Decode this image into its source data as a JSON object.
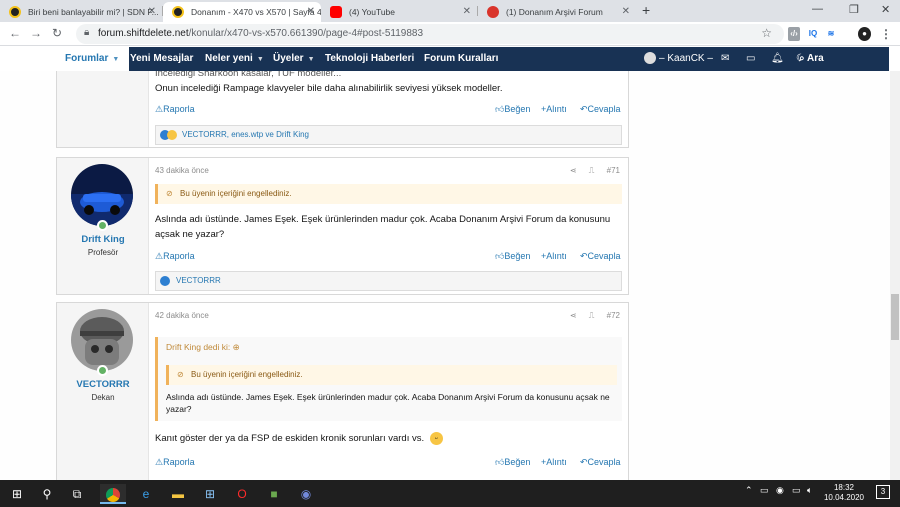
{
  "browser": {
    "tabs": [
      {
        "title": "Biri beni banlayabilir mi? | SDN F...",
        "active": false
      },
      {
        "title": "Donanım - X470 vs X570 | Sayfa 4",
        "active": true
      },
      {
        "title": "(4) YouTube",
        "active": false
      },
      {
        "title": "(1) Donanım Arşivi Forum",
        "active": false
      }
    ],
    "url_host": "forum.shiftdelete.net",
    "url_path": "/konular/x470-vs-x570.661390/page-4#post-5119883",
    "ext_iq": "IQ"
  },
  "nav": {
    "items": [
      {
        "label": "Forumlar"
      },
      {
        "label": "Yeni Mesajlar"
      },
      {
        "label": "Neler yeni"
      },
      {
        "label": "Üyeler"
      },
      {
        "label": "Teknoloji Haberleri"
      },
      {
        "label": "Forum Kuralları"
      }
    ],
    "user": "– KaanCK –",
    "search": "Ara"
  },
  "post_top": {
    "line1": "İncelediği Sharkoon kasalar, TUF modeller...",
    "line2": "Onun incelediği Rampage klavyeler bile daha alınabilirlik seviyesi yüksek modeller.",
    "report": "Raporla",
    "like": "Beğen",
    "quote": "Alıntı",
    "reply": "Cevapla",
    "reactions": "VECTORRR, enes.wtp ve Drift King"
  },
  "post71": {
    "username": "Drift King",
    "usertitle": "Profesör",
    "time": "43 dakika önce",
    "number": "#71",
    "blocked": "Bu üyenin içeriğini engellediniz.",
    "text": "Aslında adı üstünde. James Eşek. Eşek ürünlerinden madur çok. Acaba Donanım Arşivi Forum da konusunu açsak ne yazar?",
    "report": "Raporla",
    "like": "Beğen",
    "quote": "Alıntı",
    "reply": "Cevapla",
    "reactions": "VECTORRR"
  },
  "post72": {
    "username": "VECTORRR",
    "usertitle": "Dekan",
    "time": "42 dakika önce",
    "number": "#72",
    "quote_author": "Drift King dedi ki:",
    "blocked": "Bu üyenin içeriğini engellediniz.",
    "quote_text": "Aslında adı üstünde. James Eşek. Eşek ürünlerinden madur çok. Acaba Donanım Arşivi Forum da konusunu açsak ne yazar?",
    "text": "Kanıt göster der ya da FSP de eskiden kronik sorunları vardı vs.",
    "report": "Raporla",
    "like": "Beğen",
    "quote": "Alıntı",
    "reply": "Cevapla"
  },
  "taskbar": {
    "time": "18:32",
    "date": "10.04.2020",
    "notif_count": "3"
  },
  "colors": {
    "nav_bg": "#183254",
    "link": "#2577b1",
    "blocked_border": "#f0b25b"
  }
}
